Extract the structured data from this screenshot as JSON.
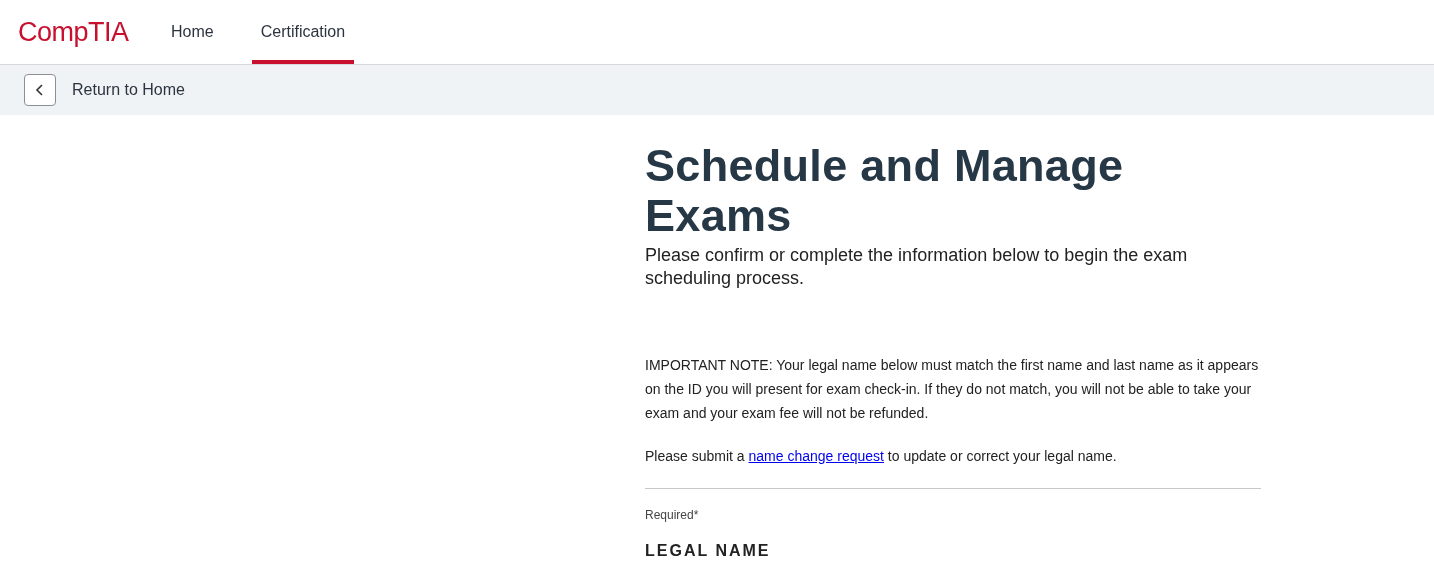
{
  "header": {
    "logo": "CompTIA",
    "nav": [
      {
        "label": "Home",
        "selected": false
      },
      {
        "label": "Certification",
        "selected": true
      }
    ]
  },
  "breadcrumb": {
    "label": "Return to Home"
  },
  "main": {
    "title": "Schedule and Manage Exams",
    "subtitle": "Please confirm or complete the information below to begin the exam scheduling process.",
    "note": "IMPORTANT NOTE: Your legal name below must match the first name and last name as it appears on the ID you will present for exam check-in. If they do not match, you will not be able to take your exam and your exam fee will not be refunded.",
    "submit": {
      "before": "Please submit a",
      "link": "name change request",
      "after": "to update or correct your legal name."
    },
    "required": "Required*",
    "section": "LEGAL NAME"
  }
}
